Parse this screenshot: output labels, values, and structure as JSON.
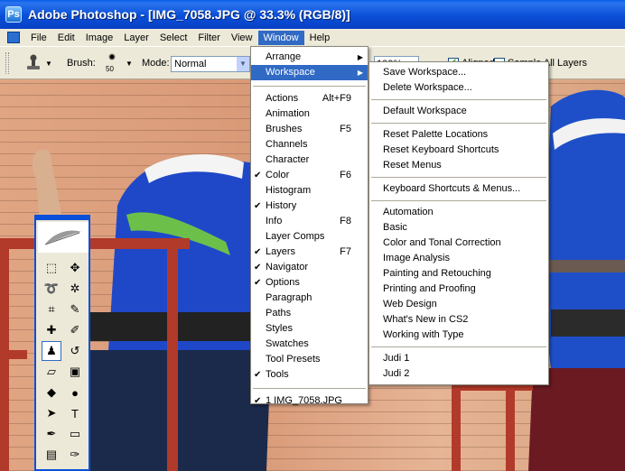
{
  "window": {
    "title": "Adobe Photoshop - [IMG_7058.JPG @ 33.3% (RGB/8)]",
    "icon_label": "Ps"
  },
  "menubar": [
    {
      "label": "File"
    },
    {
      "label": "Edit"
    },
    {
      "label": "Image"
    },
    {
      "label": "Layer"
    },
    {
      "label": "Select"
    },
    {
      "label": "Filter"
    },
    {
      "label": "View"
    },
    {
      "label": "Window",
      "active": true
    },
    {
      "label": "Help"
    }
  ],
  "options": {
    "brush_label": "Brush:",
    "brush_size": "50",
    "mode_label": "Mode:",
    "mode_value": "Normal",
    "opacity_value": "100%",
    "aligned_label": "Aligned",
    "sample_label": "Sample All Layers"
  },
  "window_menu": {
    "items": [
      {
        "label": "Arrange",
        "submenu": true
      },
      {
        "label": "Workspace",
        "submenu": true,
        "highlighted": true
      },
      {
        "separator": true
      },
      {
        "label": "Actions",
        "shortcut": "Alt+F9"
      },
      {
        "label": "Animation"
      },
      {
        "label": "Brushes",
        "shortcut": "F5"
      },
      {
        "label": "Channels"
      },
      {
        "label": "Character"
      },
      {
        "label": "Color",
        "shortcut": "F6",
        "checked": true
      },
      {
        "label": "Histogram"
      },
      {
        "label": "History",
        "checked": true
      },
      {
        "label": "Info",
        "shortcut": "F8"
      },
      {
        "label": "Layer Comps"
      },
      {
        "label": "Layers",
        "shortcut": "F7",
        "checked": true
      },
      {
        "label": "Navigator",
        "checked": true
      },
      {
        "label": "Options",
        "checked": true
      },
      {
        "label": "Paragraph"
      },
      {
        "label": "Paths"
      },
      {
        "label": "Styles"
      },
      {
        "label": "Swatches"
      },
      {
        "label": "Tool Presets"
      },
      {
        "label": "Tools",
        "checked": true
      },
      {
        "separator": true
      },
      {
        "label": "1 IMG_7058.JPG",
        "checked": true
      }
    ]
  },
  "workspace_menu": {
    "items": [
      {
        "label": "Save Workspace..."
      },
      {
        "label": "Delete Workspace..."
      },
      {
        "separator": true
      },
      {
        "label": "Default Workspace"
      },
      {
        "separator": true
      },
      {
        "label": "Reset Palette Locations"
      },
      {
        "label": "Reset Keyboard Shortcuts"
      },
      {
        "label": "Reset Menus"
      },
      {
        "separator": true
      },
      {
        "label": "Keyboard Shortcuts & Menus..."
      },
      {
        "separator": true
      },
      {
        "label": "Automation"
      },
      {
        "label": "Basic"
      },
      {
        "label": "Color and Tonal Correction"
      },
      {
        "label": "Image Analysis"
      },
      {
        "label": "Painting and Retouching"
      },
      {
        "label": "Printing and Proofing"
      },
      {
        "label": "Web Design"
      },
      {
        "label": "What's New in CS2"
      },
      {
        "label": "Working with Type"
      },
      {
        "separator": true
      },
      {
        "label": "Judi 1"
      },
      {
        "label": "Judi 2"
      }
    ]
  },
  "toolbox": {
    "tools": [
      {
        "name": "marquee-tool-icon",
        "glyph": "⬚"
      },
      {
        "name": "move-tool-icon",
        "glyph": "✥"
      },
      {
        "name": "lasso-tool-icon",
        "glyph": "➰"
      },
      {
        "name": "magic-wand-icon",
        "glyph": "✲"
      },
      {
        "name": "crop-tool-icon",
        "glyph": "⌗"
      },
      {
        "name": "slice-tool-icon",
        "glyph": "✎"
      },
      {
        "name": "healing-brush-icon",
        "glyph": "✚"
      },
      {
        "name": "brush-tool-icon",
        "glyph": "✐"
      },
      {
        "name": "clone-stamp-icon",
        "glyph": "♟",
        "selected": true
      },
      {
        "name": "history-brush-icon",
        "glyph": "↺"
      },
      {
        "name": "eraser-tool-icon",
        "glyph": "▱"
      },
      {
        "name": "gradient-tool-icon",
        "glyph": "▣"
      },
      {
        "name": "blur-tool-icon",
        "glyph": "◆"
      },
      {
        "name": "dodge-tool-icon",
        "glyph": "●"
      },
      {
        "name": "path-select-icon",
        "glyph": "➤"
      },
      {
        "name": "type-tool-icon",
        "glyph": "T"
      },
      {
        "name": "pen-tool-icon",
        "glyph": "✒"
      },
      {
        "name": "shape-tool-icon",
        "glyph": "▭"
      },
      {
        "name": "notes-tool-icon",
        "glyph": "▤"
      },
      {
        "name": "eyedropper-icon",
        "glyph": "✑"
      }
    ]
  },
  "colors": {
    "titlebar": "#0a4fd8",
    "menu_highlight": "#316ac5",
    "chrome": "#ece9d8",
    "shirt_blue": "#1f48c8",
    "pants_navy": "#1b2a4a",
    "railing": "#b23a2a"
  }
}
